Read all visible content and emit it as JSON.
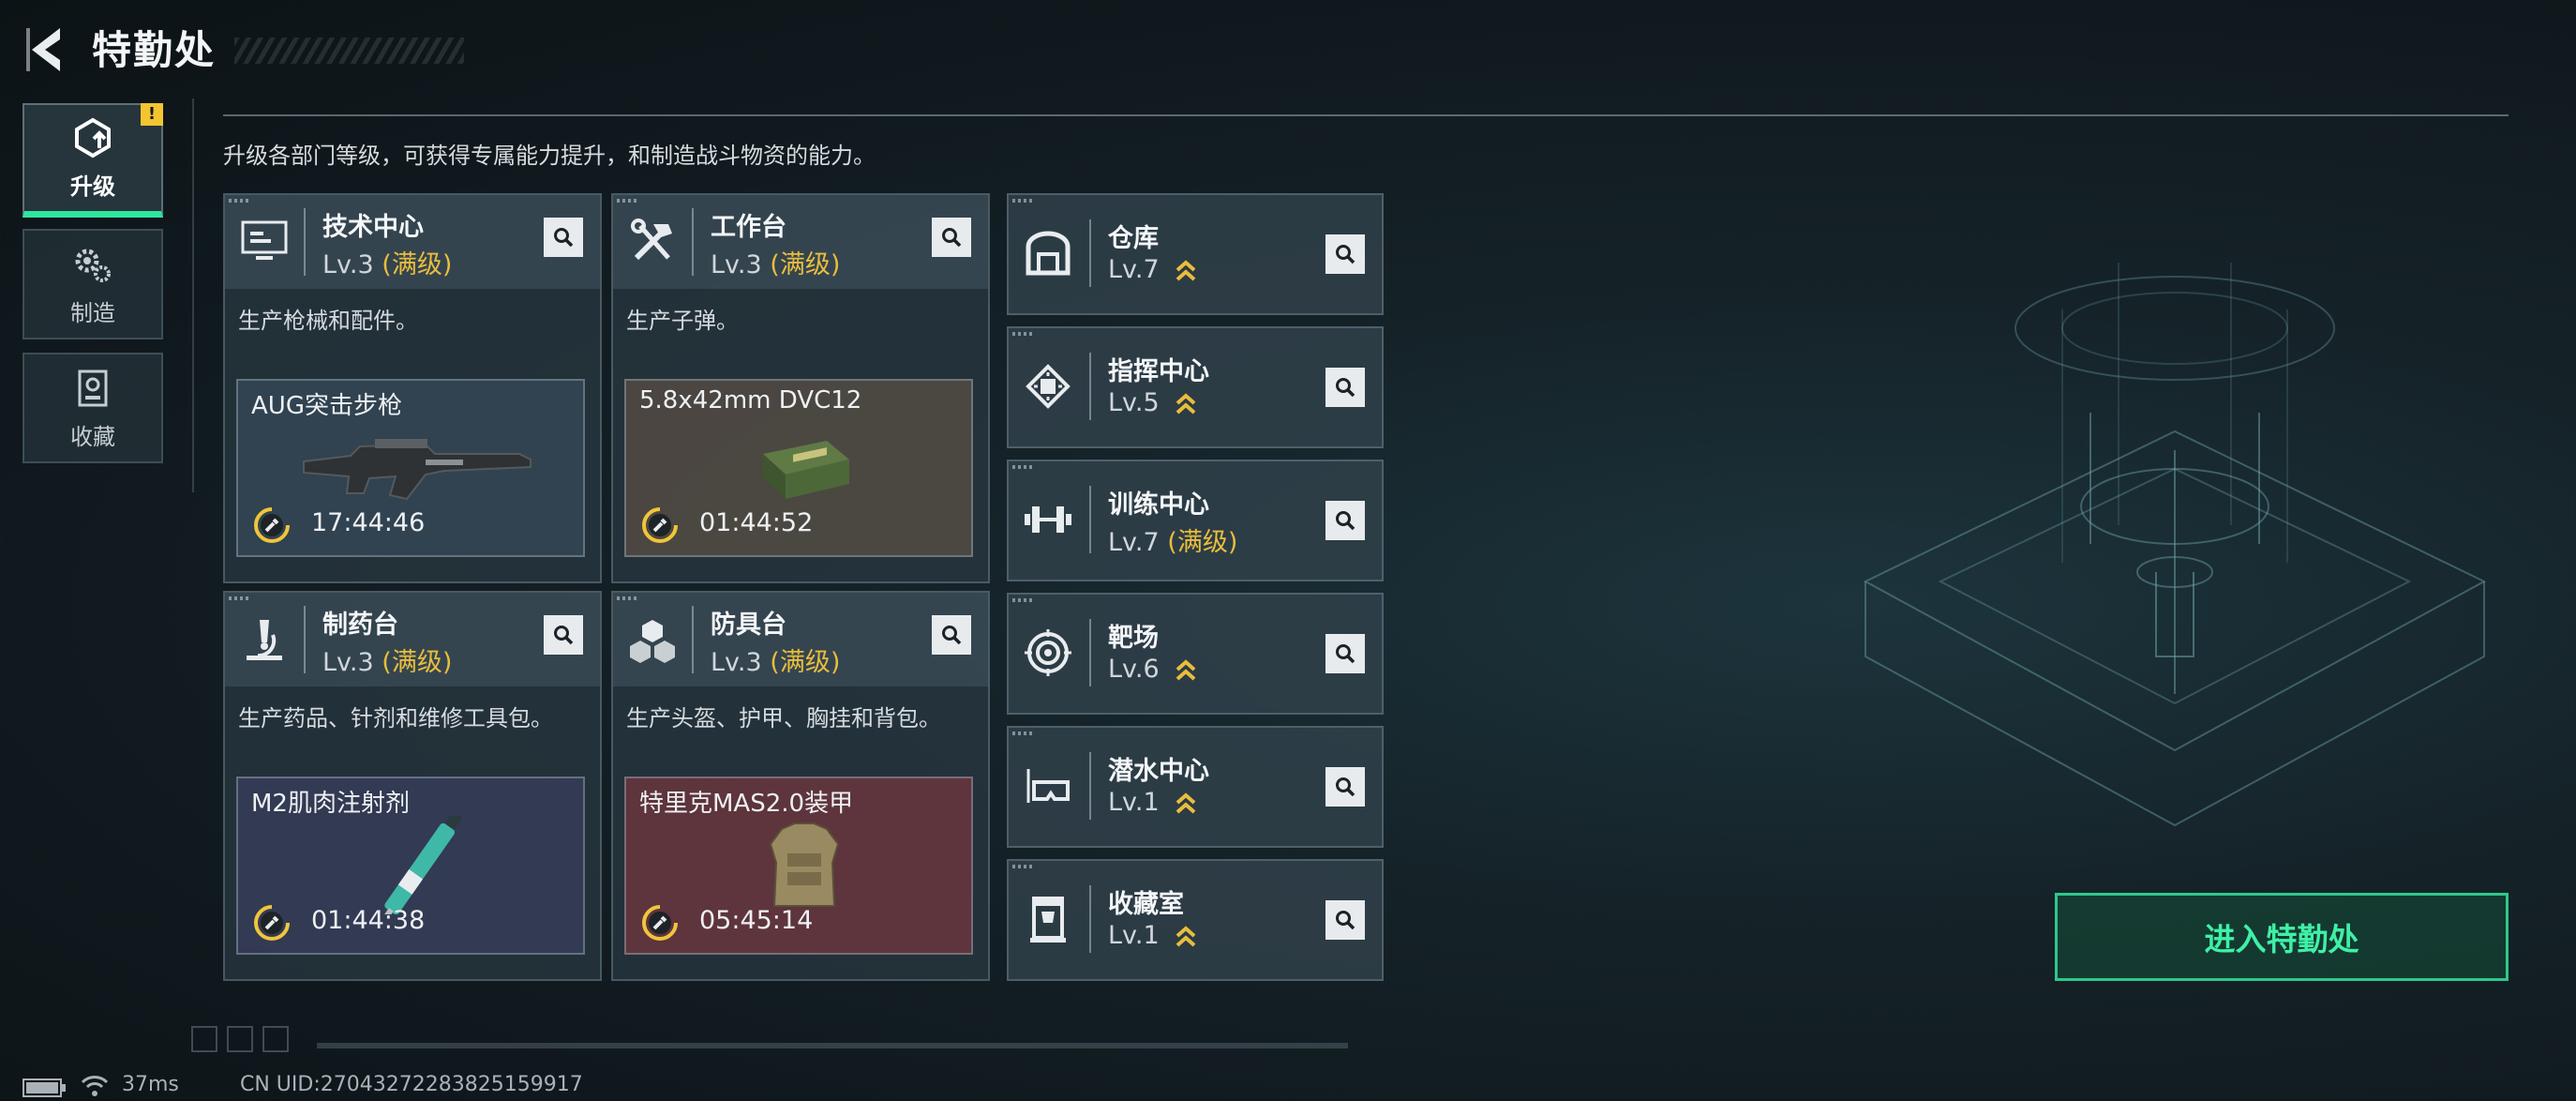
{
  "header": {
    "title": "特勤处"
  },
  "side_tabs": [
    {
      "label": "升级",
      "icon": "upgrade-icon",
      "active": true,
      "alert": "!"
    },
    {
      "label": "制造",
      "icon": "gears-icon",
      "active": false
    },
    {
      "label": "收藏",
      "icon": "collection-icon",
      "active": false
    }
  ],
  "subtitle": "升级各部门等级，可获得专属能力提升，和制造战斗物资的能力。",
  "cards": [
    {
      "name": "技术中心",
      "level": "Lv.3",
      "max_label": "(满级)",
      "desc": "生产枪械和配件。",
      "icon": "monitor-icon",
      "craft": {
        "item": "AUG突击步枪",
        "time": "17:44:46"
      }
    },
    {
      "name": "工作台",
      "level": "Lv.3",
      "max_label": "(满级)",
      "desc": "生产子弹。",
      "icon": "tools-icon",
      "craft": {
        "item": "5.8x42mm DVC12",
        "time": "01:44:52"
      }
    },
    {
      "name": "制药台",
      "level": "Lv.3",
      "max_label": "(满级)",
      "desc": "生产药品、针剂和维修工具包。",
      "icon": "microscope-icon",
      "craft": {
        "item": "M2肌肉注射剂",
        "time": "01:44:38"
      }
    },
    {
      "name": "防具台",
      "level": "Lv.3",
      "max_label": "(满级)",
      "desc": "生产头盔、护甲、胸挂和背包。",
      "icon": "cubes-icon",
      "craft": {
        "item": "特里克MAS2.0装甲",
        "time": "05:45:14"
      }
    }
  ],
  "facilities": [
    {
      "name": "仓库",
      "level": "Lv.7",
      "max_label": "",
      "upgradable": true,
      "icon": "warehouse-icon"
    },
    {
      "name": "指挥中心",
      "level": "Lv.5",
      "max_label": "",
      "upgradable": true,
      "icon": "chip-icon"
    },
    {
      "name": "训练中心",
      "level": "Lv.7",
      "max_label": "(满级)",
      "upgradable": false,
      "icon": "dumbbell-icon"
    },
    {
      "name": "靶场",
      "level": "Lv.6",
      "max_label": "",
      "upgradable": true,
      "icon": "target-icon"
    },
    {
      "name": "潜水中心",
      "level": "Lv.1",
      "max_label": "",
      "upgradable": true,
      "icon": "diving-mask-icon"
    },
    {
      "name": "收藏室",
      "level": "Lv.1",
      "max_label": "",
      "upgradable": true,
      "icon": "trophy-case-icon"
    }
  ],
  "enter_button": "进入特勤处",
  "status_bar": {
    "ping": "37ms",
    "uid": "CN UID:2704327228382515991​7"
  },
  "colors": {
    "accent_green": "#2ee59d",
    "max_level_gold": "#e9bd3d",
    "alert_yellow": "#f5c531"
  }
}
